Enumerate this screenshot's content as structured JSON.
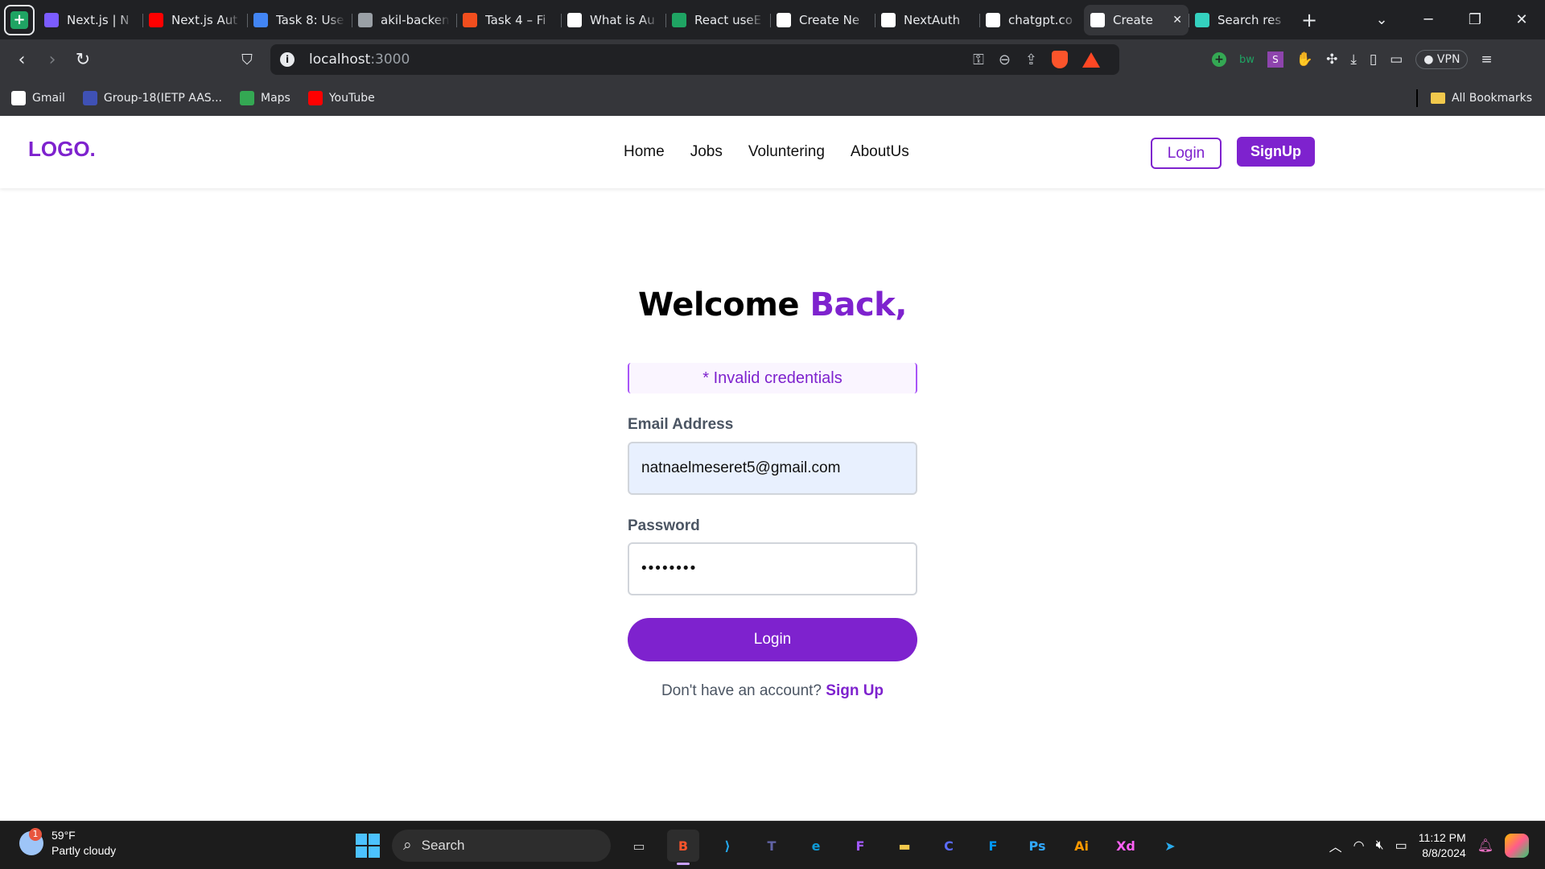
{
  "browser": {
    "tabs": [
      {
        "title": "Next.js | N",
        "icon": "vercel-shield-icon",
        "color": "#7b5cff"
      },
      {
        "title": "Next.js Aut",
        "icon": "youtube-icon",
        "color": "#ff0000"
      },
      {
        "title": "Task 8: Use",
        "icon": "google-docs-icon",
        "color": "#4285f4"
      },
      {
        "title": "akil-backen",
        "icon": "globe-icon",
        "color": "#9aa0a6"
      },
      {
        "title": "Task 4 – Fi",
        "icon": "figma-icon",
        "color": "#f24e1e"
      },
      {
        "title": "What is Au",
        "icon": "medium-icon",
        "color": "#ffffff"
      },
      {
        "title": "React useE",
        "icon": "w-icon",
        "color": "#1fa463"
      },
      {
        "title": "Create Ne",
        "icon": "vercel-triangle-icon",
        "color": "#ffffff"
      },
      {
        "title": "NextAuth",
        "icon": "openai-icon",
        "color": "#ffffff"
      },
      {
        "title": "chatgpt.co",
        "icon": "openai-icon",
        "color": "#ffffff"
      },
      {
        "title": "Create",
        "icon": "vercel-triangle-icon",
        "color": "#ffffff",
        "active": true
      },
      {
        "title": "Search res",
        "icon": "v-icon",
        "color": "#34d1bf"
      }
    ],
    "url_host": "localhost",
    "url_port": ":3000",
    "vpn_label": "VPN",
    "ext_labels": {
      "bw": "bw",
      "s": "S"
    },
    "bookmarks": [
      {
        "label": "Gmail",
        "icon": "google-icon",
        "color": "#ffffff"
      },
      {
        "label": "Group-18(IETP AAS...",
        "icon": "forms-icon",
        "color": "#3f51b5"
      },
      {
        "label": "Maps",
        "icon": "maps-pin-icon",
        "color": "#34a853"
      },
      {
        "label": "YouTube",
        "icon": "youtube-icon",
        "color": "#ff0000"
      }
    ],
    "all_bookmarks_label": "All Bookmarks"
  },
  "site": {
    "logo": "LOGO.",
    "nav": [
      "Home",
      "Jobs",
      "Voluntering",
      "AboutUs"
    ],
    "login_button": "Login",
    "signup_button": "SignUp",
    "accent_color": "#7e22ce"
  },
  "login_form": {
    "title_part1": "Welcome",
    "title_part2": "Back,",
    "error_message": "* Invalid credentials",
    "email_label": "Email Address",
    "email_value": "natnaelmeseret5@gmail.com",
    "password_label": "Password",
    "password_value": "••••••••",
    "submit_label": "Login",
    "no_account_text": "Don't have an account?",
    "signup_link": "Sign Up"
  },
  "taskbar": {
    "weather_temp": "59°F",
    "weather_desc": "Partly cloudy",
    "weather_badge": "1",
    "search_label": "Search",
    "apps": [
      {
        "name": "task-view",
        "glyph": "▭",
        "color": "#cccccc"
      },
      {
        "name": "brave",
        "glyph": "B",
        "color": "#fb542b",
        "active": true
      },
      {
        "name": "vscode",
        "glyph": "⟩",
        "color": "#23a9f2"
      },
      {
        "name": "teams",
        "glyph": "T",
        "color": "#6264a7"
      },
      {
        "name": "edge",
        "glyph": "e",
        "color": "#0f9bd7"
      },
      {
        "name": "figma",
        "glyph": "F",
        "color": "#a259ff"
      },
      {
        "name": "file-explorer",
        "glyph": "▬",
        "color": "#f2c94c"
      },
      {
        "name": "capcut",
        "glyph": "C",
        "color": "#5b6cff"
      },
      {
        "name": "framer",
        "glyph": "F",
        "color": "#0099ff"
      },
      {
        "name": "photoshop",
        "glyph": "Ps",
        "color": "#31a8ff"
      },
      {
        "name": "illustrator",
        "glyph": "Ai",
        "color": "#ff9a00"
      },
      {
        "name": "xd",
        "glyph": "Xd",
        "color": "#ff61f6"
      },
      {
        "name": "telegram",
        "glyph": "➤",
        "color": "#2aabee"
      }
    ],
    "time": "11:12 PM",
    "date": "8/8/2024"
  }
}
